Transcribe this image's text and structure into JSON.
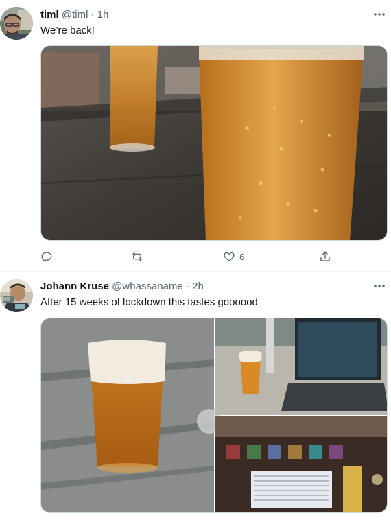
{
  "tweets": [
    {
      "author_name": "timl",
      "handle": "@timl",
      "separator": "·",
      "time": "1h",
      "text": "We’re back!",
      "actions": {
        "reply_count": "",
        "retweet_count": "",
        "like_count": "6"
      }
    },
    {
      "author_name": "Johann Kruse",
      "handle": "@whassaname",
      "separator": "·",
      "time": "2h",
      "text": "After 15 weeks of lockdown this tastes goooood"
    }
  ],
  "icons": {
    "more": "more-horizontal-icon",
    "reply": "reply-icon",
    "retweet": "retweet-icon",
    "like": "heart-icon",
    "share": "share-icon"
  },
  "colors": {
    "text_primary": "#0f1419",
    "text_secondary": "#536471",
    "divider": "#eff3f4"
  }
}
